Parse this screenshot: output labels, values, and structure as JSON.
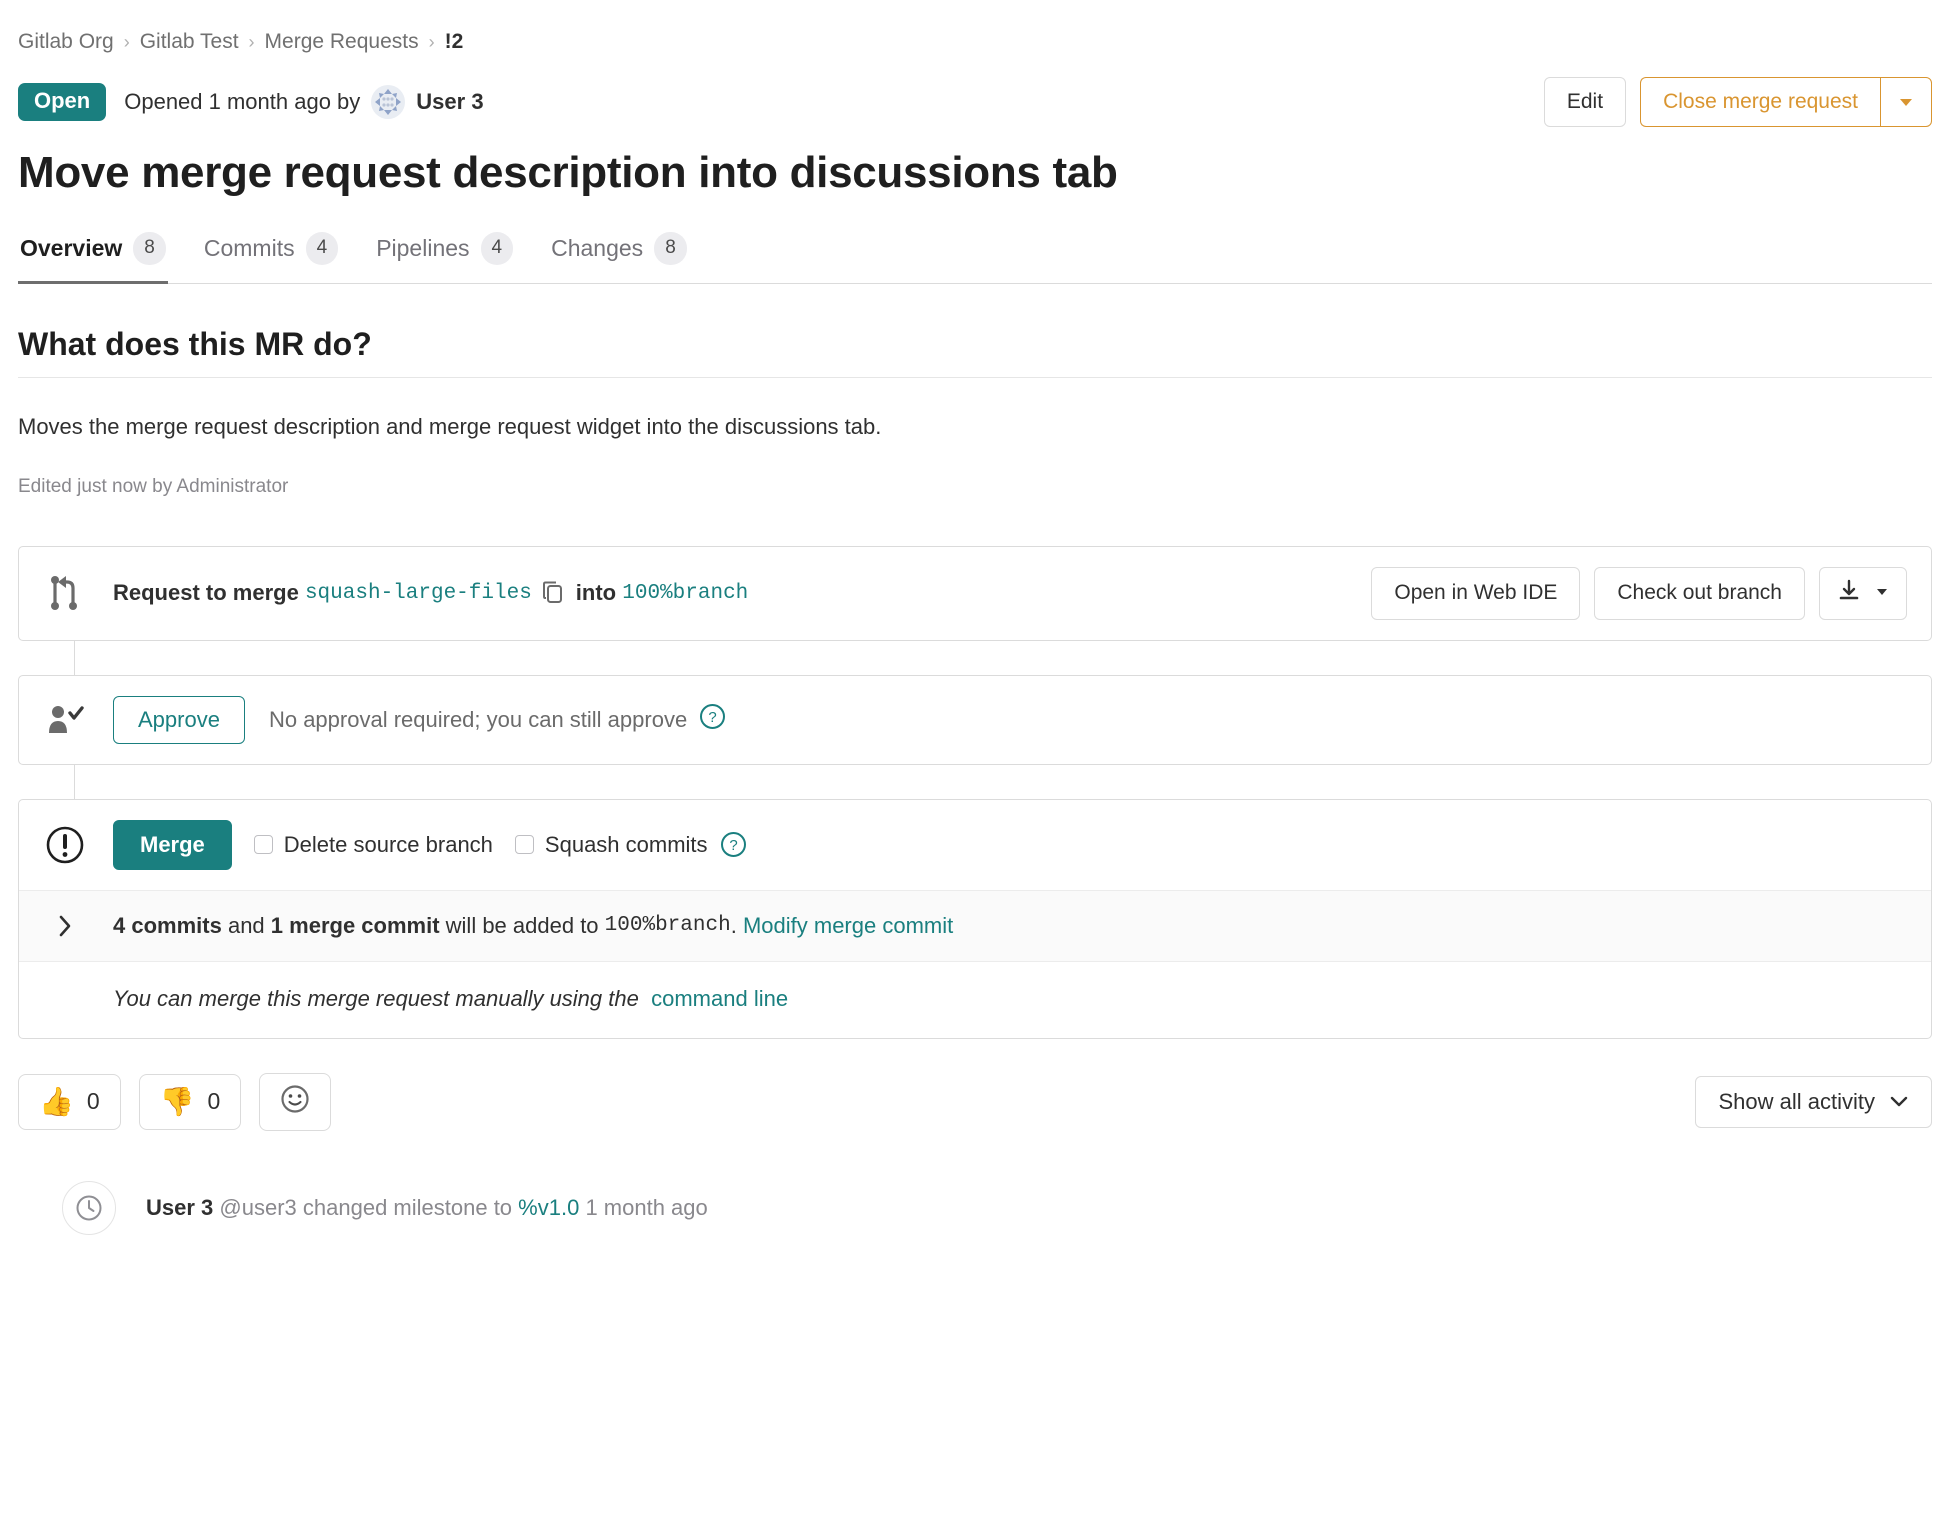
{
  "breadcrumb": {
    "items": [
      {
        "label": "Gitlab Org"
      },
      {
        "label": "Gitlab Test"
      },
      {
        "label": "Merge Requests"
      },
      {
        "label": "!2"
      }
    ],
    "separator": "›"
  },
  "status": {
    "badge": "Open",
    "opened_text": "Opened 1 month ago by",
    "author": "User 3"
  },
  "actions": {
    "edit": "Edit",
    "close": "Close merge request",
    "caret": "▾"
  },
  "title": "Move merge request description into discussions tab",
  "tabs": [
    {
      "label": "Overview",
      "count": "8",
      "active": true
    },
    {
      "label": "Commits",
      "count": "4",
      "active": false
    },
    {
      "label": "Pipelines",
      "count": "4",
      "active": false
    },
    {
      "label": "Changes",
      "count": "8",
      "active": false
    }
  ],
  "description": {
    "heading": "What does this MR do?",
    "body": "Moves the merge request description and merge request widget into the discussions tab.",
    "edited": "Edited just now by Administrator"
  },
  "merge_widget": {
    "request_label": "Request to merge",
    "source_branch": "squash-large-files",
    "into_label": "into",
    "target_branch": "100%branch",
    "open_web_ide": "Open in Web IDE",
    "check_out_branch": "Check out branch",
    "download_caret": "▾"
  },
  "approval": {
    "button": "Approve",
    "note": "No approval required; you can still approve",
    "help": "?"
  },
  "merge": {
    "button": "Merge",
    "delete_source_branch": "Delete source branch",
    "squash_commits": "Squash commits",
    "help": "?",
    "commits_summary": {
      "chevron": "›",
      "count": "4 commits",
      "and": "and",
      "merge_commit": "1 merge commit",
      "tail": "will be added to",
      "target": "100%branch",
      "period": ".",
      "modify_link": "Modify merge commit"
    },
    "manual_text": "You can merge this merge request manually using the",
    "manual_link": "command line"
  },
  "reactions": [
    {
      "emoji": "👍",
      "name": "thumbs-up",
      "count": "0"
    },
    {
      "emoji": "👎",
      "name": "thumbs-down",
      "count": "0"
    }
  ],
  "add_reaction": {
    "icon": "☺"
  },
  "show_activity": {
    "label": "Show all activity",
    "caret": "⌄"
  },
  "activity": [
    {
      "user": "User 3",
      "handle": "@user3",
      "action": "changed milestone to",
      "milestone": "%v1.0",
      "time": "1 month ago"
    }
  ],
  "colors": {
    "teal": "#1a7f7f",
    "orange": "#d99530",
    "text": "#303030",
    "muted": "#89888d",
    "border": "#dbdbdb"
  }
}
